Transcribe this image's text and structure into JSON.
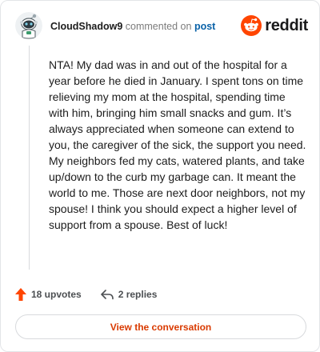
{
  "comment": {
    "username": "CloudShadow9",
    "action_text": "commented on",
    "post_link": "post",
    "body": "NTA! My dad was in and out of the hospital for a year before he died in January. I spent tons on time relieving my mom at the hospital, spending time with him, bringing him small snacks and gum. It’s always appreciated when someone can extend to you, the caregiver of the sick, the support you need. My neighbors fed my cats, watered plants, and take up/down to the curb my garbage can. It meant the world to me. Those are next door neighbors, not my spouse! I think you should expect a higher level of support from a spouse. Best of luck!"
  },
  "brand": {
    "name": "reddit",
    "color": "#ff4500"
  },
  "footer": {
    "upvotes_label": "18 upvotes",
    "replies_label": "2 replies",
    "cta_label": "View the conversation",
    "upvote_icon": "upvote-arrow-icon",
    "reply_icon": "reply-arrow-icon",
    "upvote_color": "#ff4500",
    "cta_color": "#d93a00"
  }
}
